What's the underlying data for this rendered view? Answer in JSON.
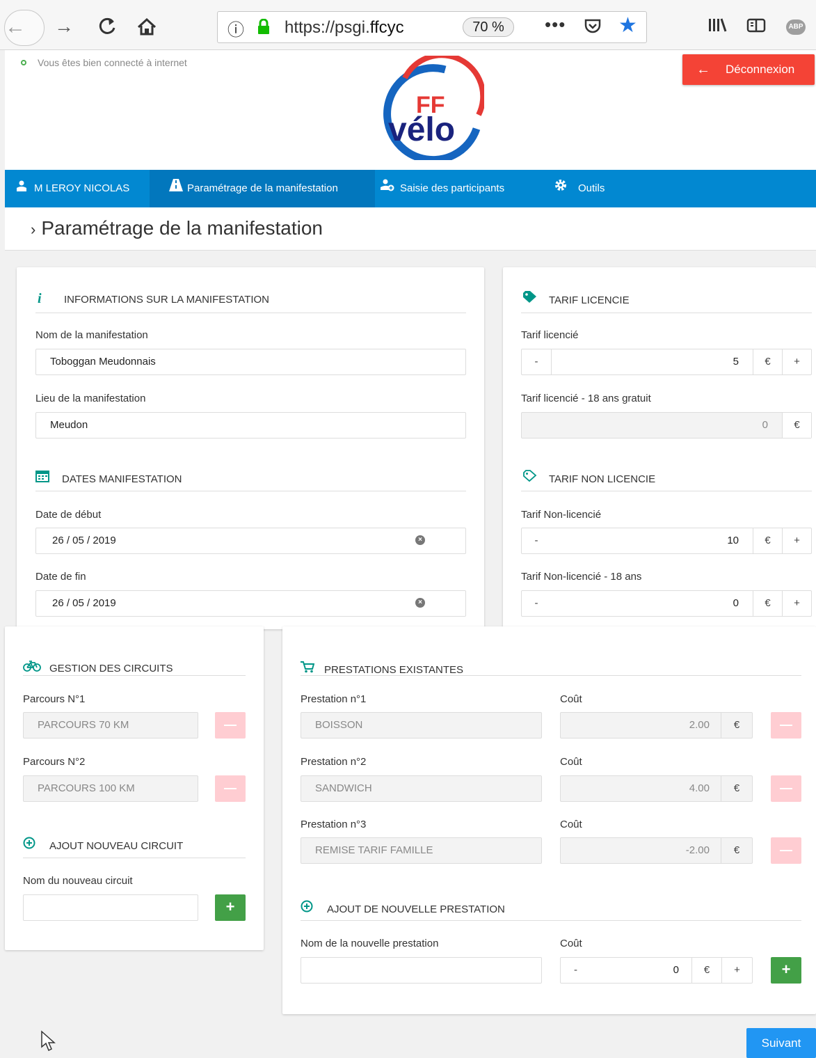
{
  "browser": {
    "url_prefix": "https://psgi.",
    "url_host": "ffcyc",
    "zoom": "70 %",
    "more_menu": "•••",
    "ext_label": "ABP",
    "icons": [
      "back-arrow-icon",
      "forward-arrow-icon",
      "reload-icon",
      "home-icon",
      "info-icon",
      "lock-icon",
      "pocket-icon",
      "bookmark-star-icon",
      "library-icon",
      "reader-view-icon",
      "adblock-icon"
    ]
  },
  "header": {
    "connection_status": "Vous êtes bien connecté à internet",
    "logout_label": "Déconnexion",
    "logo_text_top": "FF",
    "logo_text_bottom": "vélo"
  },
  "nav": {
    "user": "M LEROY NICOLAS",
    "param": "Paramétrage de la manifestation",
    "saisie": "Saisie des participants",
    "outils": "Outils"
  },
  "page": {
    "title": "Paramétrage de la manifestation",
    "next_label": "Suivant"
  },
  "info": {
    "section_title": "INFORMATIONS SUR LA MANIFESTATION",
    "name_label": "Nom de la manifestation",
    "name_value": "Toboggan Meudonnais",
    "place_label": "Lieu de la manifestation",
    "place_value": "Meudon"
  },
  "dates": {
    "section_title": "DATES MANIFESTATION",
    "start_label": "Date de début",
    "start_value": "26 / 05 / 2019",
    "end_label": "Date de fin",
    "end_value": "26 / 05 / 2019"
  },
  "tarif_licencie": {
    "section_title": "TARIF LICENCIE",
    "label": "Tarif licencié",
    "value": "5",
    "minus18_label": "Tarif licencié - 18 ans gratuit",
    "minus18_value": "0",
    "currency": "€",
    "minus": "-",
    "plus": "+"
  },
  "tarif_non_licencie": {
    "section_title": "TARIF NON LICENCIE",
    "label": "Tarif Non-licencié",
    "value": "10",
    "minus18_label": "Tarif Non-licencié - 18 ans",
    "minus18_value": "0"
  },
  "circuits": {
    "section_title": "GESTION DES CIRCUITS",
    "items": [
      {
        "label": "Parcours N°1",
        "value": "PARCOURS 70 KM"
      },
      {
        "label": "Parcours N°2",
        "value": "PARCOURS 100 KM"
      }
    ],
    "add_title": "AJOUT NOUVEAU CIRCUIT",
    "new_label": "Nom du nouveau circuit",
    "new_value": ""
  },
  "prestations": {
    "section_title": "PRESTATIONS EXISTANTES",
    "cost_label": "Coût",
    "items": [
      {
        "label": "Prestation n°1",
        "value": "BOISSON",
        "cost": "2.00"
      },
      {
        "label": "Prestation n°2",
        "value": "SANDWICH",
        "cost": "4.00"
      },
      {
        "label": "Prestation n°3",
        "value": "REMISE TARIF FAMILLE",
        "cost": "-2.00"
      }
    ],
    "add_title": "AJOUT DE NOUVELLE PRESTATION",
    "new_label": "Nom de la nouvelle prestation",
    "new_value": "",
    "new_cost": "0"
  },
  "colors": {
    "nav": "#0288d1",
    "nav_active": "#0277bd",
    "danger": "#f44336",
    "success": "#43a047",
    "primary": "#2196f3"
  }
}
